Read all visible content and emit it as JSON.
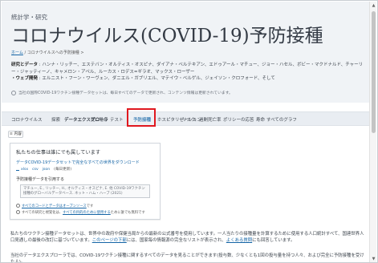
{
  "header": {
    "kicker": "統計学・研究",
    "title": "コロナウイルス(COVID-19)予防接種",
    "breadcrumb": {
      "link": "ホーム",
      "sep1": " / ",
      "current": "コロナウイルスへの予防接種",
      "trail": " >"
    },
    "authors": {
      "label1": "研究とデータ",
      "text1": " : ハンナ・リッチー、エステバン・オルティス・オスピナ、ダイアナ・ベルテキアン、エドゥアール・マチュー、ジョー・ハセル、ボビー・マクドナルド、チャーリー・ジャッティーノ、キャメロン・アペル、ルーカス・ロデス=ギラオ、マックス・ローザー",
      "label2": "・ウェブ開発",
      "text2": " : エルニスト・フーン・ワーヴェン、ダニエル・ガブリエル、マテイウ・ベルゲル、ジェイソン・クロフォード、そして"
    },
    "notice": "当社の国際COVID-19ワクチン接種データセットは、毎日すべてのデータで更新され、コンテンツ情報は更新されています。"
  },
  "nav": {
    "items": [
      "コロナウイルス",
      "探索",
      "データエクスプローラ",
      "死亡",
      "場合",
      "テスト",
      "予防接種",
      "ホスピタリゼーション",
      "リスク",
      "過剰死亡率",
      "ポリシーの応答",
      "寿命",
      "すべてのグラフ"
    ],
    "active": "予防接種"
  },
  "contents_button": "≡ 内容",
  "card": {
    "title": "私たちの仕事は誰にでも属しています",
    "download_link": "データCOVID-19データセットで完全なすべての世界をダウンロード",
    "file_links": [
      "xlsx",
      "csv",
      "json"
    ],
    "file_note": "(毎日更新)",
    "cite_label": "予防接種データを引用する",
    "cite_text": "マチュー, E., リッチー, H., オルティス・オスピナ, E. 他 COVID-19ワクチン接種のグローバルデータベース. ネット・ハム・ハーブ (2021)",
    "license1_link": "すべてのコードとデータはオープンソース",
    "license1_text": "です",
    "license2_text": "すべての研究と視覚化は、",
    "license2_link": "すべての目的のために使用する",
    "license2_tail": "ために誰でも無料です"
  },
  "body": {
    "p1_a": "私たちのワクチン接種データセットは、世界中の政府や保健当局からの最新の公式番号を使用しています。一人当たりの接種量を計算するために使用する人口統計すべて、国連世界人口見通しの最後の改訂に基づいています。",
    "p1_link1": "このページの下部",
    "p1_b": "には、国家毎の情報源の完全なリストが表示され、",
    "p1_link2": "よくある質問",
    "p1_c": "にも回答しています。",
    "p2": "当社のデータエクスプローラでは、COVID-19ワクチン接種に関するすべてのデータを見ることができます(投与数、少なくとも1回の投与量を持つ人々、および完全に予防接種を受けた人)。"
  }
}
